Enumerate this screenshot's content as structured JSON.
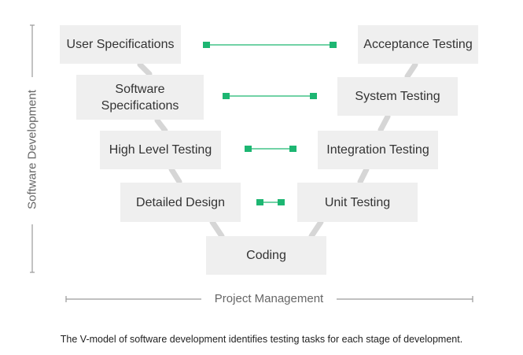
{
  "colors": {
    "link": "#1db672",
    "box": "#efefef",
    "connector": "#d6d6d6",
    "axis": "#9a9a9a"
  },
  "axes": {
    "vertical_label": "Software Development",
    "horizontal_label": "Project Management"
  },
  "left_stages": [
    "User Specifications",
    "Software\nSpecifications",
    "High Level Testing",
    "Detailed Design"
  ],
  "right_stages": [
    "Acceptance Testing",
    "System Testing",
    "Integration Testing",
    "Unit Testing"
  ],
  "bottom_stage": "Coding",
  "caption": "The V-model of software development identifies testing tasks for each stage of development."
}
